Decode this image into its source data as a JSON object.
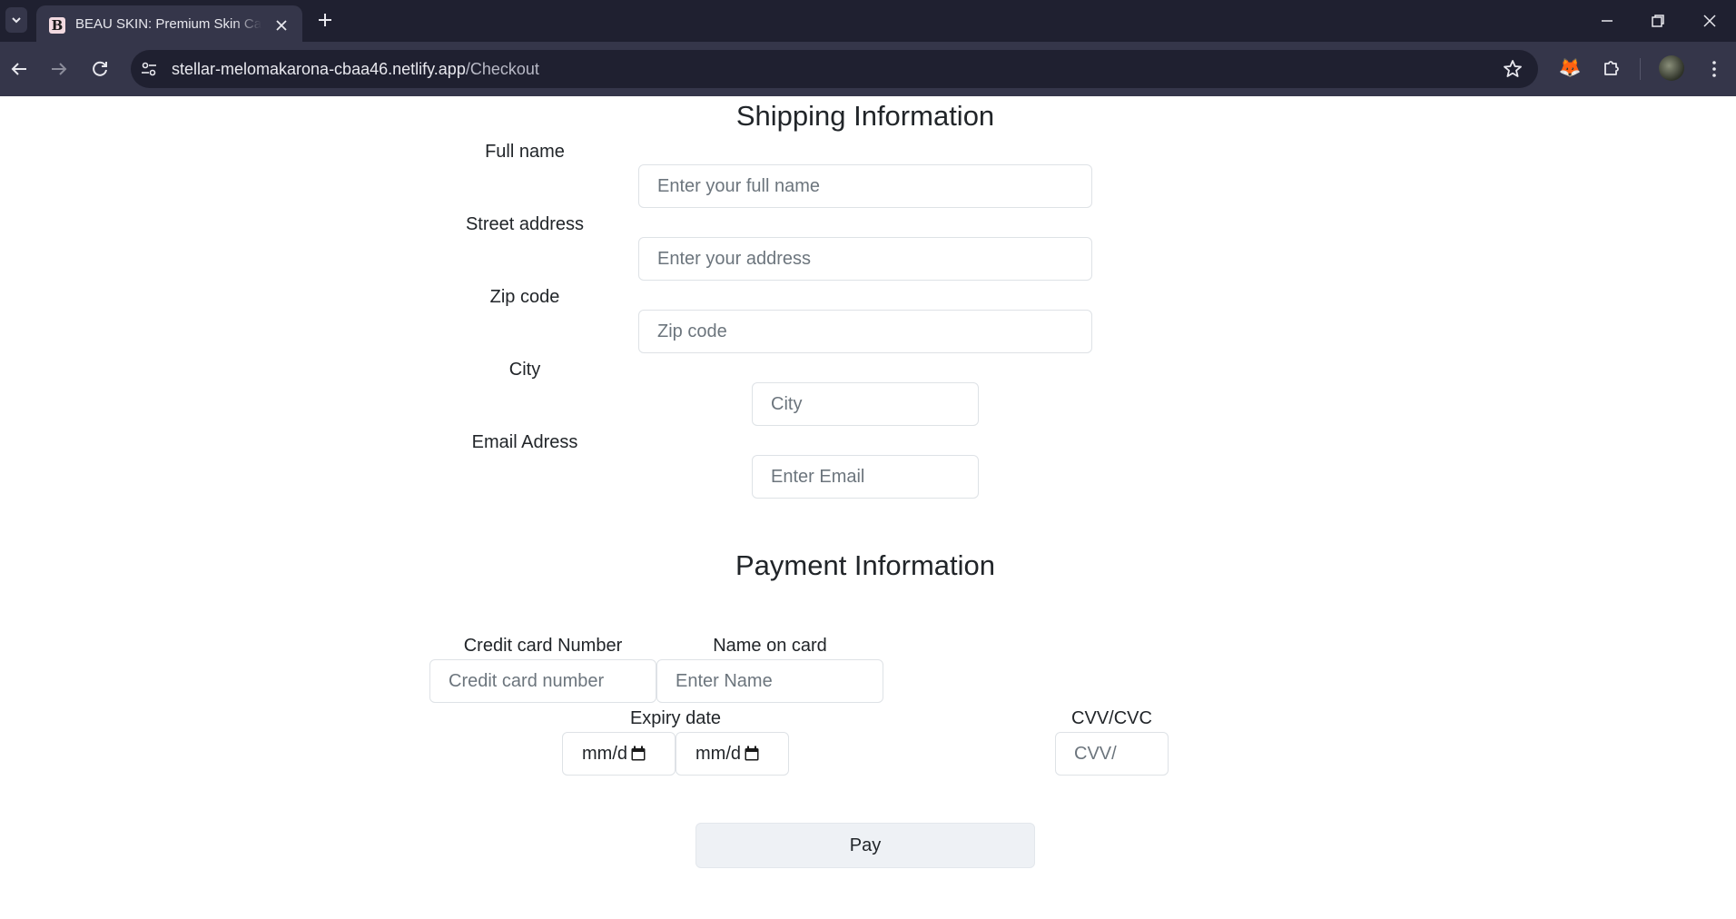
{
  "browser": {
    "tab_title": "BEAU SKIN: Premium Skin Care",
    "tab_favicon_letter": "B",
    "url_host": "stellar-melomakarona-cbaa46.netlify.app",
    "url_path": "/Checkout"
  },
  "shipping": {
    "title": "Shipping Information",
    "full_name_label": "Full name",
    "full_name_placeholder": "Enter your full name",
    "street_label": "Street address",
    "street_placeholder": "Enter your address",
    "zip_label": "Zip code",
    "zip_placeholder": "Zip code",
    "city_label": "City",
    "city_placeholder": "City",
    "email_label": "Email Adress",
    "email_placeholder": "Enter Email"
  },
  "payment": {
    "title": "Payment Information",
    "card_number_label": "Credit card Number",
    "card_number_placeholder": "Credit card number",
    "name_on_card_label": "Name on card",
    "name_on_card_placeholder": "Enter Name",
    "expiry_label": "Expiry date",
    "expiry_month_text": "mm/d",
    "expiry_year_text": "mm/d",
    "cvv_label": "CVV/CVC",
    "cvv_placeholder": "CVV/",
    "pay_label": "Pay"
  }
}
